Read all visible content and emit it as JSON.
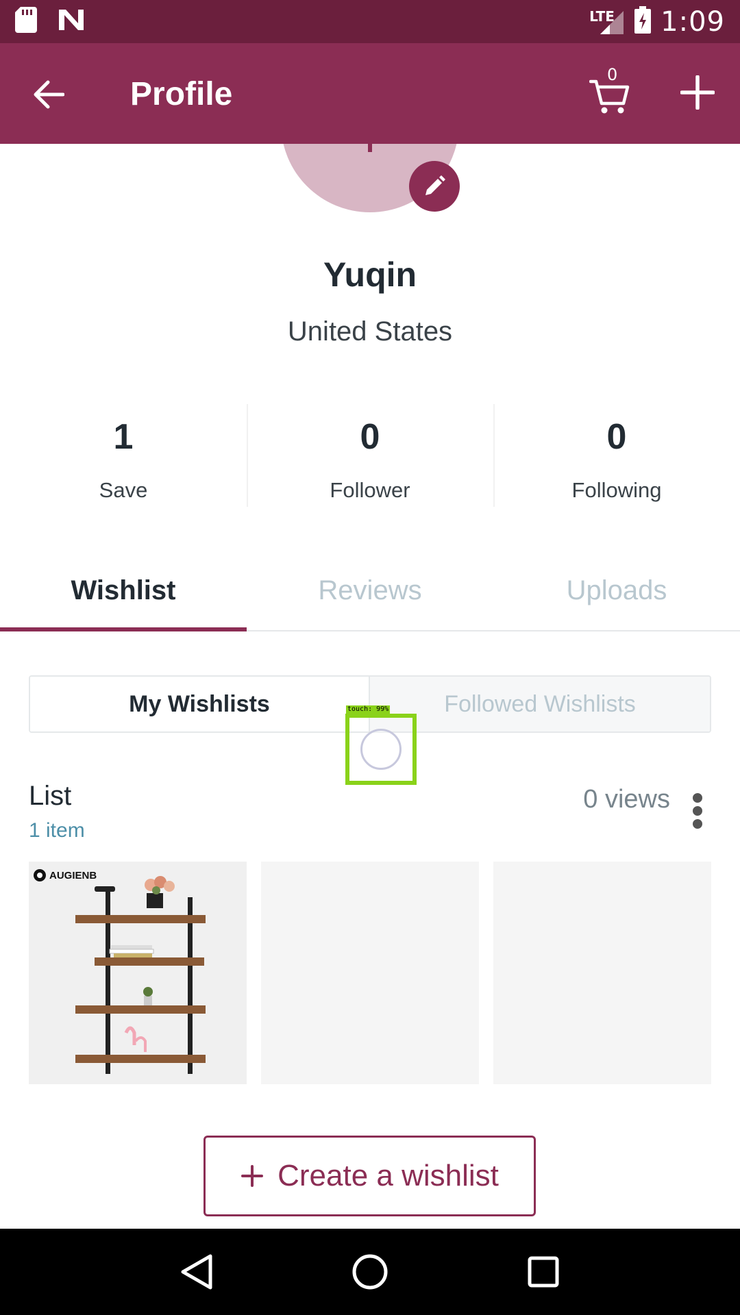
{
  "status_bar": {
    "network": "LTE",
    "time": "1:09"
  },
  "app_bar": {
    "title": "Profile",
    "cart_count": "0"
  },
  "profile": {
    "name": "Yuqin",
    "location": "United States"
  },
  "stats": [
    {
      "value": "1",
      "label": "Save"
    },
    {
      "value": "0",
      "label": "Follower"
    },
    {
      "value": "0",
      "label": "Following"
    }
  ],
  "tabs": [
    {
      "label": "Wishlist",
      "active": true
    },
    {
      "label": "Reviews",
      "active": false
    },
    {
      "label": "Uploads",
      "active": false
    }
  ],
  "segment": {
    "mine": "My Wishlists",
    "followed": "Followed Wishlists"
  },
  "touch_indicator": {
    "label": "touch: 99%"
  },
  "list": {
    "title": "List",
    "count": "1 item",
    "views": "0 views",
    "brand": "AUGIENB"
  },
  "create_button": {
    "label": "Create a wishlist"
  },
  "colors": {
    "primary": "#8b2d54",
    "status_bar": "#6b1f3d",
    "accent_text": "#4d8fa8"
  }
}
